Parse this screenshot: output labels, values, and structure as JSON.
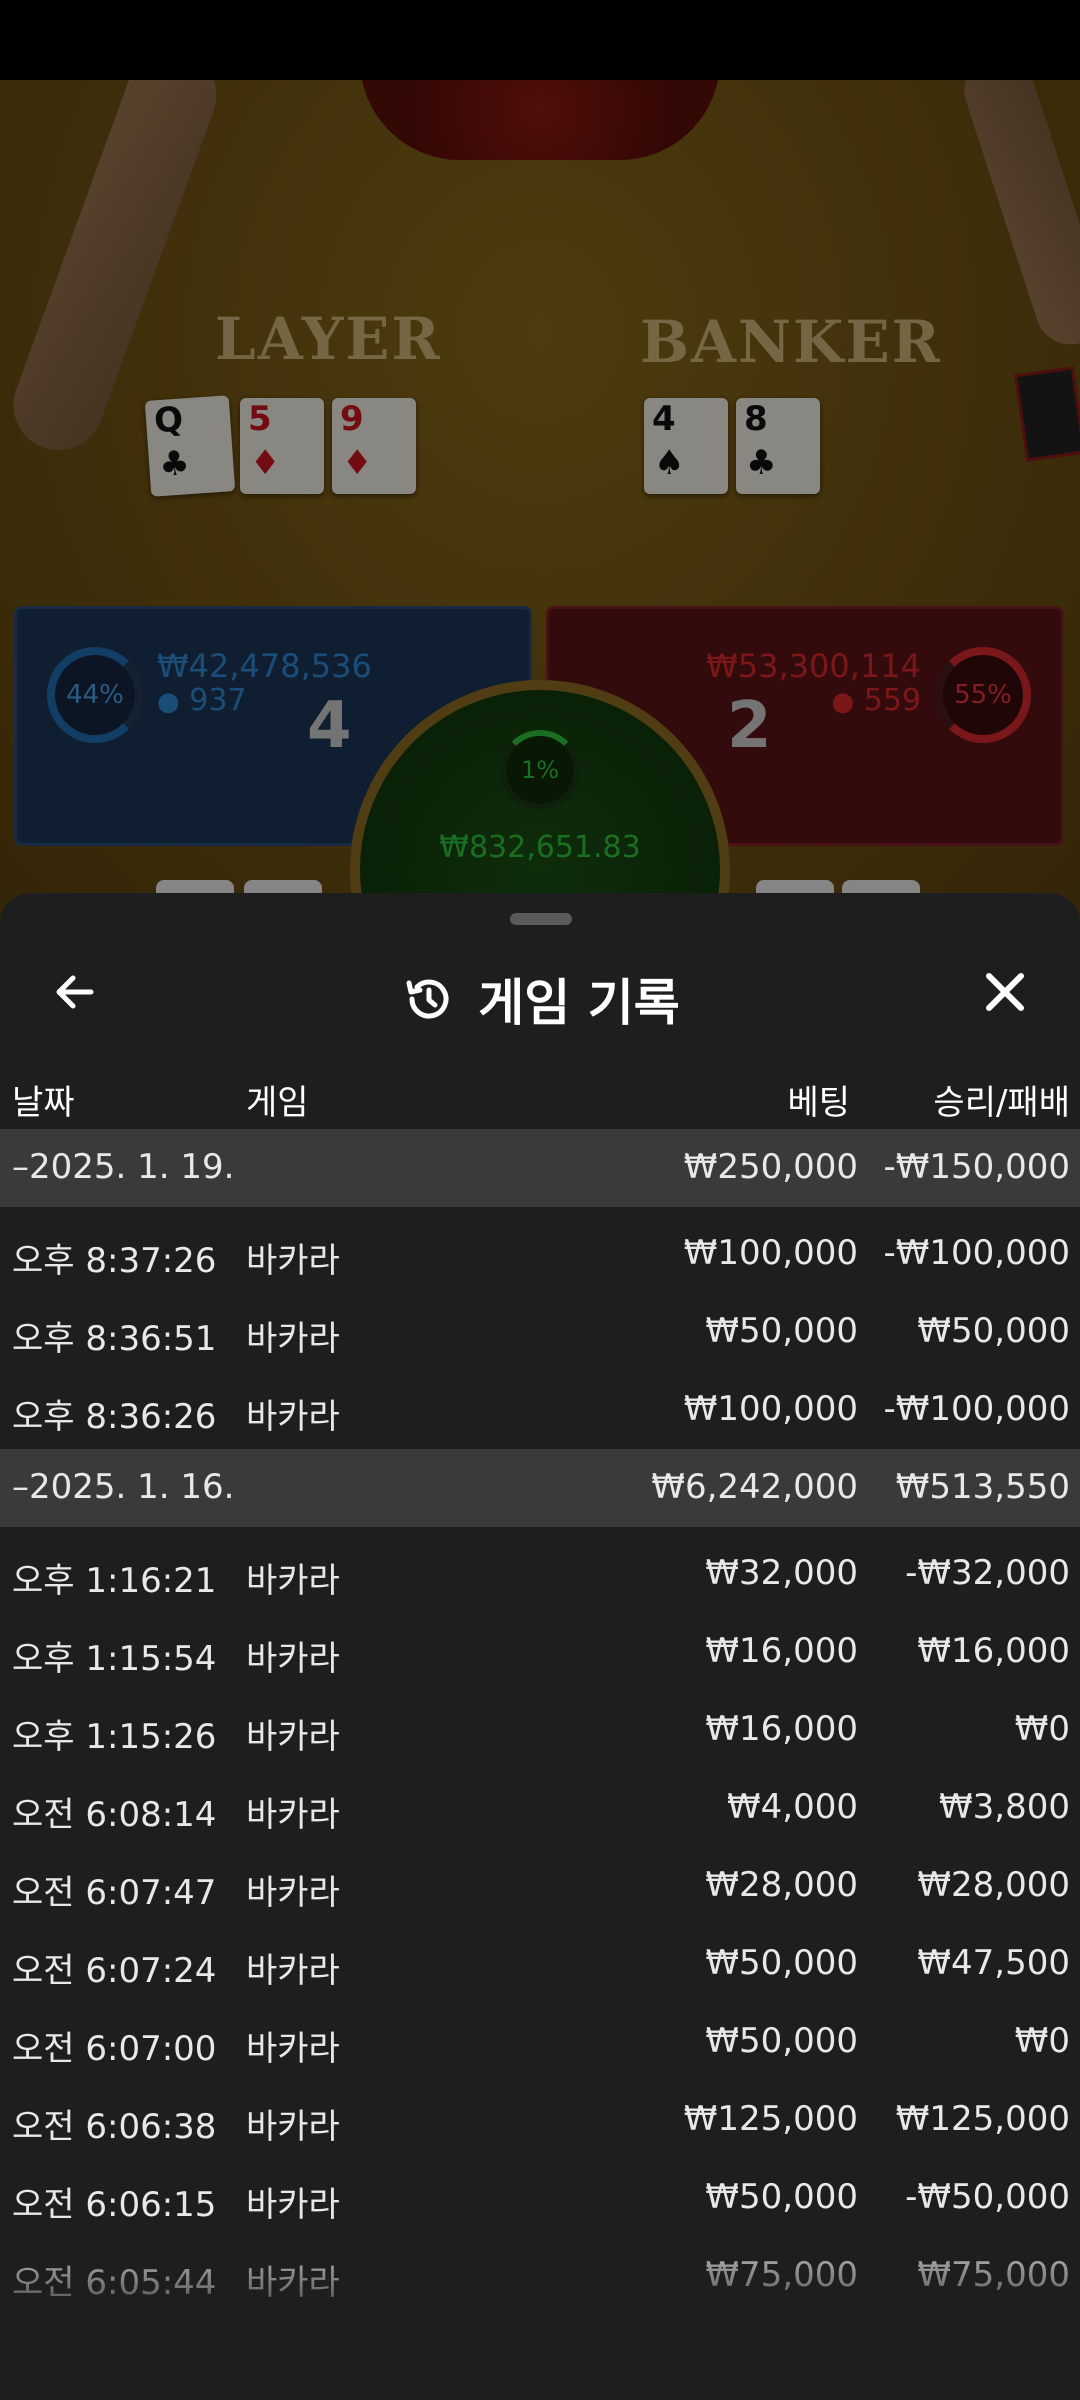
{
  "game_view": {
    "player_label": "LAYER",
    "banker_label": "BANKER",
    "player_cards": [
      {
        "rank": "Q",
        "suit": "♣",
        "color": "black"
      },
      {
        "rank": "5",
        "suit": "♦",
        "color": "red"
      },
      {
        "rank": "9",
        "suit": "♦",
        "color": "red"
      }
    ],
    "banker_cards": [
      {
        "rank": "4",
        "suit": "♠",
        "color": "black"
      },
      {
        "rank": "8",
        "suit": "♣",
        "color": "black"
      }
    ],
    "player_box": {
      "percent": "44%",
      "amount": "₩42,478,536",
      "count": "937",
      "score": "4",
      "color": "#2f86d0"
    },
    "banker_box": {
      "percent": "55%",
      "amount": "₩53,300,114",
      "count": "559",
      "score": "2",
      "color": "#d4262c"
    },
    "tie_box": {
      "percent": "1%",
      "amount": "₩832,651.83",
      "color": "#2ebd3a"
    }
  },
  "sheet": {
    "title": "게임 기록",
    "columns": {
      "date": "날짜",
      "game": "게임",
      "bet": "베팅",
      "winloss": "승리/패배"
    },
    "groups": [
      {
        "date": "–2025. 1. 19.",
        "bet": "₩250,000",
        "winloss": "-₩150,000",
        "rows": [
          {
            "time": "오후 8:37:26",
            "game": "바카라",
            "bet": "₩100,000",
            "winloss": "-₩100,000"
          },
          {
            "time": "오후 8:36:51",
            "game": "바카라",
            "bet": "₩50,000",
            "winloss": "₩50,000"
          },
          {
            "time": "오후 8:36:26",
            "game": "바카라",
            "bet": "₩100,000",
            "winloss": "-₩100,000"
          }
        ]
      },
      {
        "date": "–2025. 1. 16.",
        "bet": "₩6,242,000",
        "winloss": "₩513,550",
        "rows": [
          {
            "time": "오후 1:16:21",
            "game": "바카라",
            "bet": "₩32,000",
            "winloss": "-₩32,000"
          },
          {
            "time": "오후 1:15:54",
            "game": "바카라",
            "bet": "₩16,000",
            "winloss": "₩16,000"
          },
          {
            "time": "오후 1:15:26",
            "game": "바카라",
            "bet": "₩16,000",
            "winloss": "₩0"
          },
          {
            "time": "오전 6:08:14",
            "game": "바카라",
            "bet": "₩4,000",
            "winloss": "₩3,800"
          },
          {
            "time": "오전 6:07:47",
            "game": "바카라",
            "bet": "₩28,000",
            "winloss": "₩28,000"
          },
          {
            "time": "오전 6:07:24",
            "game": "바카라",
            "bet": "₩50,000",
            "winloss": "₩47,500"
          },
          {
            "time": "오전 6:07:00",
            "game": "바카라",
            "bet": "₩50,000",
            "winloss": "₩0"
          },
          {
            "time": "오전 6:06:38",
            "game": "바카라",
            "bet": "₩125,000",
            "winloss": "₩125,000"
          },
          {
            "time": "오전 6:06:15",
            "game": "바카라",
            "bet": "₩50,000",
            "winloss": "-₩50,000"
          },
          {
            "time": "오전 6:05:44",
            "game": "바카라",
            "bet": "₩75,000",
            "winloss": "₩75,000"
          }
        ]
      }
    ]
  },
  "icons": {
    "back": "arrow-left-icon",
    "history": "history-icon",
    "close": "close-icon",
    "person": "person-icon"
  }
}
